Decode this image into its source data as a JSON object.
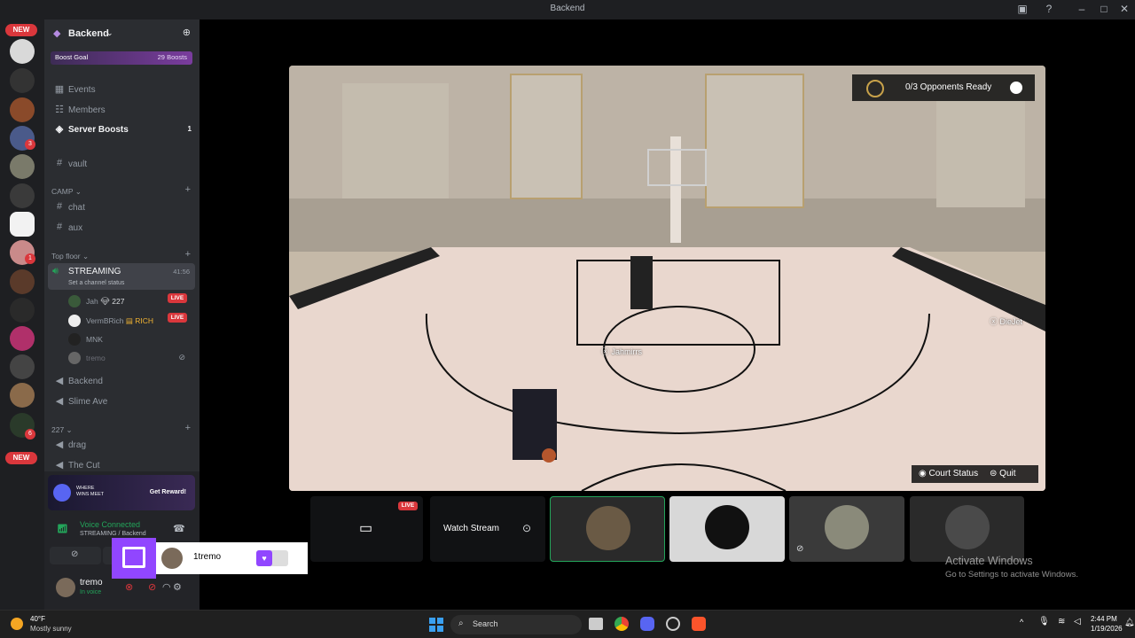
{
  "window": {
    "title": "Backend"
  },
  "rail": {
    "new_badge_top": "NEW",
    "new_badge_bottom": "NEW",
    "badges": [
      "3",
      "1",
      "6"
    ]
  },
  "server": {
    "name": "Backend",
    "boost_goal_label": "Boost Goal",
    "boost_count": "29 Boosts",
    "nav": [
      {
        "label": "Events"
      },
      {
        "label": "Members"
      },
      {
        "label": "Server Boosts",
        "count": "1"
      }
    ]
  },
  "channels": {
    "vault": "vault",
    "camp_category": "CAMP",
    "chat": "chat",
    "aux": "aux",
    "topfloor_category": "Top floor",
    "streaming": {
      "name": "STREAMING",
      "timer": "41:56",
      "status": "Set a channel status"
    },
    "voice_users": [
      {
        "name": "Jah",
        "tag": "227",
        "live": "LIVE"
      },
      {
        "name": "VermBRich",
        "tag": "RICH",
        "live": "LIVE"
      },
      {
        "name": "MNK"
      },
      {
        "name": "tremo"
      }
    ],
    "backend": "Backend",
    "slime": "Slime Ave",
    "cat227": "227",
    "drag": "drag",
    "thecut": "The Cut"
  },
  "promo": {
    "button": "Get Reward!",
    "brand": "WHERE WINS MEET"
  },
  "voice": {
    "status": "Voice Connected",
    "channel": "STREAMING / Backend"
  },
  "user": {
    "name": "tremo",
    "status": "In voice"
  },
  "twitch_popup": {
    "name": "1tremo"
  },
  "game": {
    "opponents": "0/3 Opponents Ready",
    "player1": "Jahmirrs",
    "player2": "DieJet",
    "court_status": "Court Status",
    "quit": "Quit"
  },
  "stream_tiles": {
    "live": "LIVE",
    "watch": "Watch Stream"
  },
  "activate": {
    "title": "Activate Windows",
    "sub": "Go to Settings to activate Windows."
  },
  "taskbar": {
    "temp": "40°F",
    "weather": "Mostly sunny",
    "search": "Search",
    "time": "2:44 PM",
    "date": "1/19/2026"
  },
  "colors": {
    "accent": "#5865f2",
    "live": "#da373c",
    "online": "#23a55a",
    "twitch": "#9146ff"
  }
}
